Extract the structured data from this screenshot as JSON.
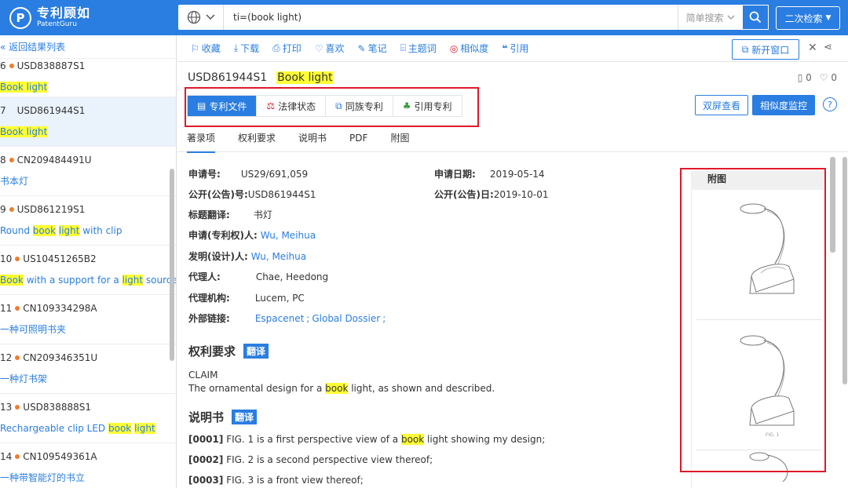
{
  "brand": {
    "name_cn": "专利顾如",
    "name_en": "PatentGuru"
  },
  "search": {
    "query": "ti=(book light)",
    "mode": "简单搜索",
    "second_search": "二次检索"
  },
  "left": {
    "back_label": "« 返回结果列表",
    "results": [
      {
        "num": "6",
        "id": "USD838887S1",
        "title": [
          {
            "t": "Book light",
            "h": true
          }
        ]
      },
      {
        "num": "7",
        "id": "USD861944S1",
        "title": [
          {
            "t": "Book light",
            "h": true
          }
        ],
        "selected": true
      },
      {
        "num": "8",
        "id": "CN209484491U",
        "title": [
          {
            "t": "书本灯",
            "h": false
          }
        ]
      },
      {
        "num": "9",
        "id": "USD861219S1",
        "title": [
          {
            "t": "Round ",
            "h": false
          },
          {
            "t": "book",
            "h": true
          },
          {
            "t": " ",
            "h": false
          },
          {
            "t": "light",
            "h": true
          },
          {
            "t": " with clip",
            "h": false
          }
        ]
      },
      {
        "num": "10",
        "id": "US10451265B2",
        "title": [
          {
            "t": "Book",
            "h": true
          },
          {
            "t": " with a support for a ",
            "h": false
          },
          {
            "t": "light",
            "h": true
          },
          {
            "t": " source",
            "h": false
          }
        ]
      },
      {
        "num": "11",
        "id": "CN109334298A",
        "title": [
          {
            "t": "一种可照明书夹",
            "h": false
          }
        ]
      },
      {
        "num": "12",
        "id": "CN209346351U",
        "title": [
          {
            "t": "一种灯书架",
            "h": false
          }
        ]
      },
      {
        "num": "13",
        "id": "USD838888S1",
        "title": [
          {
            "t": "Rechargeable clip LED ",
            "h": false
          },
          {
            "t": "book",
            "h": true
          },
          {
            "t": " ",
            "h": false
          },
          {
            "t": "light",
            "h": true
          }
        ]
      },
      {
        "num": "14",
        "id": "CN109549361A",
        "title": [
          {
            "t": "一种带智能灯的书立",
            "h": false
          }
        ]
      }
    ]
  },
  "toolbar": {
    "favorite": "收藏",
    "download": "下载",
    "print": "打印",
    "like": "喜欢",
    "note": "笔记",
    "topic": "主题词",
    "similarity": "相似度",
    "cite": "引用",
    "new_window": "新开窗口"
  },
  "detail": {
    "patent_no": "USD861944S1",
    "title": "Book light",
    "bookmarks": "0",
    "likes": "0",
    "tabs": [
      "专利文件",
      "法律状态",
      "同族专利",
      "引用专利"
    ],
    "dual_view": "双屏查看",
    "monitor": "相似度监控",
    "subtabs": [
      "著录项",
      "权利要求",
      "说明书",
      "PDF",
      "附图"
    ],
    "biblio": {
      "app_no_label": "申请号:",
      "app_no": "US29/691,059",
      "app_date_label": "申请日期:",
      "app_date": "2019-05-14",
      "pub_no_label": "公开(公告)号:",
      "pub_no": "USD861944S1",
      "pub_date_label": "公开(公告)日:",
      "pub_date": "2019-10-01",
      "title_trans_label": "标题翻译:",
      "title_trans": "书灯",
      "applicant_label": "申请(专利权)人:",
      "applicant": "Wu, Meihua",
      "inventor_label": "发明(设计)人:",
      "inventor": "Wu, Meihua",
      "agent_label": "代理人:",
      "agent": "Chae, Heedong",
      "agency_label": "代理机构:",
      "agency": "Lucem, PC",
      "links_label": "外部链接:",
      "link1": "Espacenet",
      "link_sep": ";",
      "link2": "Global Dossier",
      "link_end": ";"
    },
    "claims": {
      "heading": "权利要求",
      "translate": "翻译",
      "label": "CLAIM",
      "text_pre": "The ornamental design for a ",
      "hl": "book",
      "text_post": " light, as shown and described."
    },
    "desc": {
      "heading": "说明书",
      "translate": "翻译",
      "p1_num": "[0001]",
      "p1_pre": " FIG. 1 is a first perspective view of a ",
      "p1_hl": "book",
      "p1_post": " light showing my design;",
      "p2_num": "[0002]",
      "p2": " FIG. 2 is a second perspective view thereof;",
      "p3_num": "[0003]",
      "p3": " FIG. 3 is a front view thereof;"
    },
    "figures": {
      "heading": "附图",
      "caption": "FIG. 1"
    }
  },
  "colors": {
    "accent": "#2a7de1",
    "highlight": "#ffff33",
    "annotation": "#e0192a",
    "dot": "#f07d2c"
  }
}
